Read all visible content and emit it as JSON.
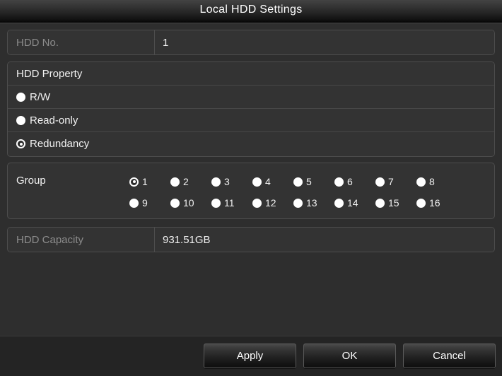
{
  "window": {
    "title": "Local HDD Settings"
  },
  "fields": {
    "hdd_no": {
      "label": "HDD No.",
      "value": "1"
    },
    "hdd_capacity": {
      "label": "HDD Capacity",
      "value": "931.51GB"
    }
  },
  "hdd_property": {
    "header": "HDD Property",
    "options": [
      {
        "label": "R/W",
        "selected": false
      },
      {
        "label": "Read-only",
        "selected": false
      },
      {
        "label": "Redundancy",
        "selected": true
      }
    ]
  },
  "group": {
    "label": "Group",
    "selected": "1",
    "row1": [
      {
        "label": "1",
        "selected": true
      },
      {
        "label": "2",
        "selected": false
      },
      {
        "label": "3",
        "selected": false
      },
      {
        "label": "4",
        "selected": false
      },
      {
        "label": "5",
        "selected": false
      },
      {
        "label": "6",
        "selected": false
      },
      {
        "label": "7",
        "selected": false
      },
      {
        "label": "8",
        "selected": false
      }
    ],
    "row2": [
      {
        "label": "9",
        "selected": false
      },
      {
        "label": "10",
        "selected": false
      },
      {
        "label": "11",
        "selected": false
      },
      {
        "label": "12",
        "selected": false
      },
      {
        "label": "13",
        "selected": false
      },
      {
        "label": "14",
        "selected": false
      },
      {
        "label": "15",
        "selected": false
      },
      {
        "label": "16",
        "selected": false
      }
    ]
  },
  "footer": {
    "apply_label": "Apply",
    "ok_label": "OK",
    "cancel_label": "Cancel"
  },
  "colors": {
    "window_bg": "#2e2e2e",
    "panel_bg": "#333333",
    "panel_border": "#4d4d4d",
    "footer_bg": "#242424",
    "text_primary": "#f2f2f2",
    "text_muted": "#8c8c8c",
    "radio_fill": "#ffffff"
  }
}
